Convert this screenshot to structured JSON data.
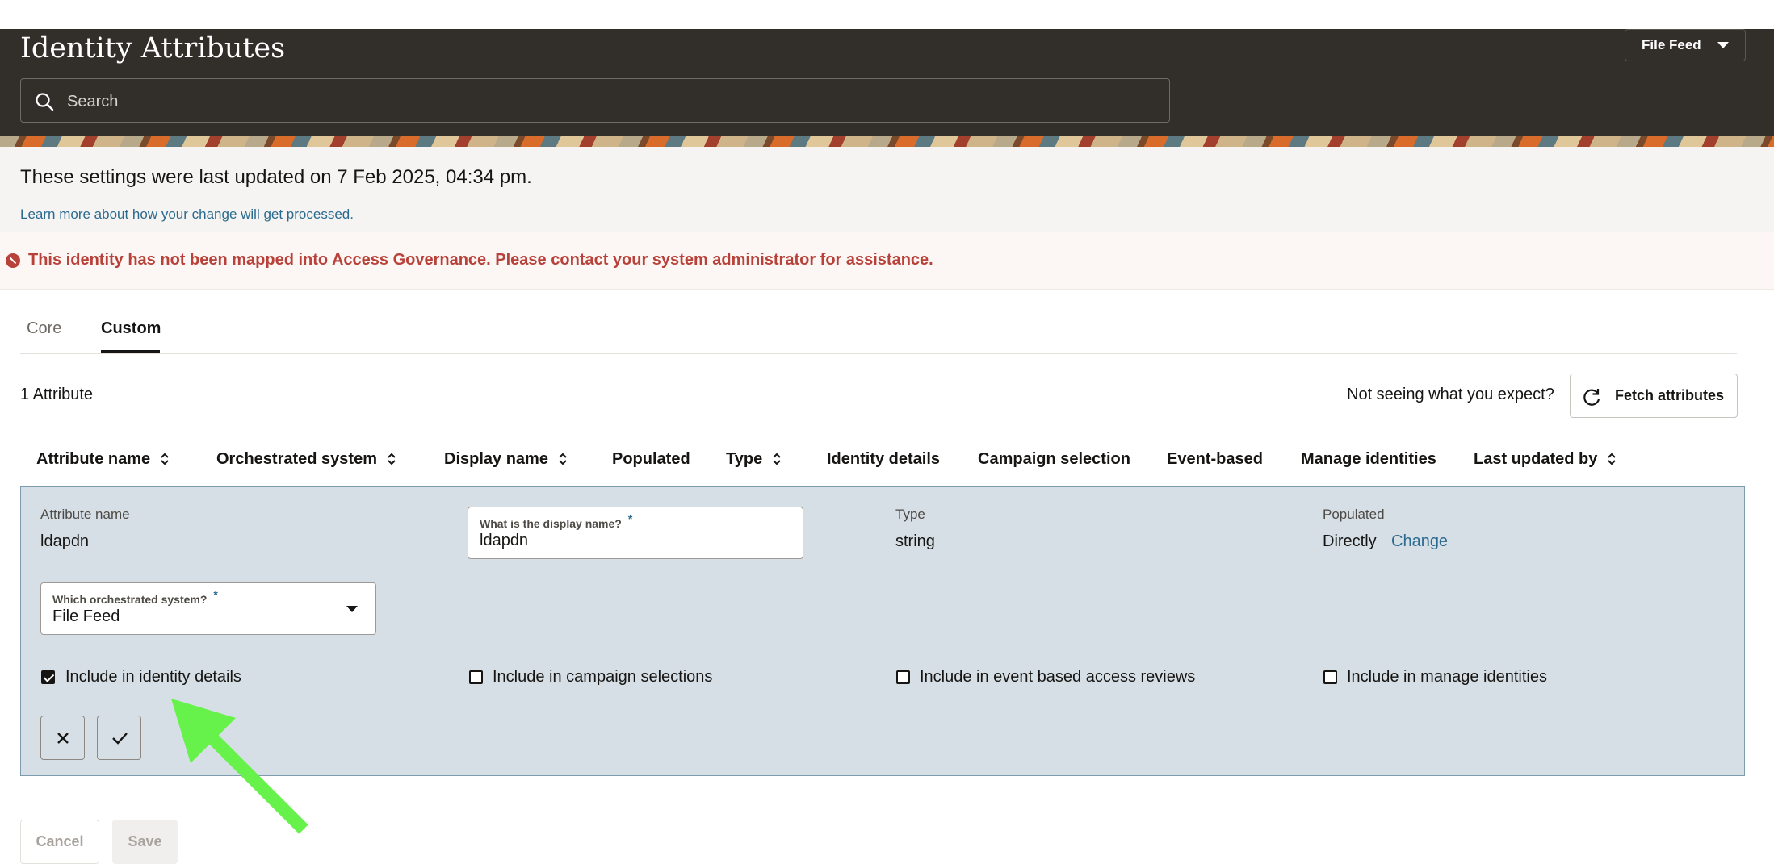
{
  "header": {
    "title": "Identity Attributes",
    "feed_selector": "File Feed",
    "search_placeholder": "Search"
  },
  "info": {
    "last_updated": "These settings were last updated on 7 Feb 2025, 04:34 pm.",
    "learn_more": "Learn more about how your change will get processed."
  },
  "error": {
    "message": "This identity has not been mapped into Access Governance. Please contact your system administrator for assistance."
  },
  "tabs": [
    {
      "label": "Core",
      "active": false
    },
    {
      "label": "Custom",
      "active": true
    }
  ],
  "toolbar": {
    "count": "1 Attribute",
    "not_seeing": "Not seeing what you expect?",
    "fetch_label": "Fetch attributes"
  },
  "table": {
    "columns": [
      {
        "label": "Attribute name",
        "sortable": true
      },
      {
        "label": "Orchestrated system",
        "sortable": true
      },
      {
        "label": "Display name",
        "sortable": true
      },
      {
        "label": "Populated",
        "sortable": false
      },
      {
        "label": "Type",
        "sortable": true
      },
      {
        "label": "Identity details",
        "sortable": false
      },
      {
        "label": "Campaign selection",
        "sortable": false
      },
      {
        "label": "Event-based",
        "sortable": false
      },
      {
        "label": "Manage identities",
        "sortable": false
      },
      {
        "label": "Last updated by",
        "sortable": true
      }
    ]
  },
  "edit": {
    "attribute_name_label": "Attribute name",
    "attribute_name": "ldapdn",
    "display_name_label": "What is the display name?",
    "display_name_value": "ldapdn",
    "type_label": "Type",
    "type_value": "string",
    "populated_label": "Populated",
    "populated_value": "Directly",
    "change_label": "Change",
    "system_label": "Which orchestrated system?",
    "system_value": "File Feed",
    "required_marker": "*",
    "checkboxes": [
      {
        "label": "Include in identity details",
        "checked": true
      },
      {
        "label": "Include in campaign selections",
        "checked": false
      },
      {
        "label": "Include in event based access reviews",
        "checked": false
      },
      {
        "label": "Include in manage identities",
        "checked": false
      }
    ]
  },
  "footer": {
    "cancel": "Cancel",
    "save": "Save"
  },
  "colors": {
    "header_bg": "#322e2a",
    "error": "#b8423a",
    "link": "#2b6a8f",
    "panel_bg": "#d6dfe6",
    "annotation_arrow": "#66f24a"
  }
}
